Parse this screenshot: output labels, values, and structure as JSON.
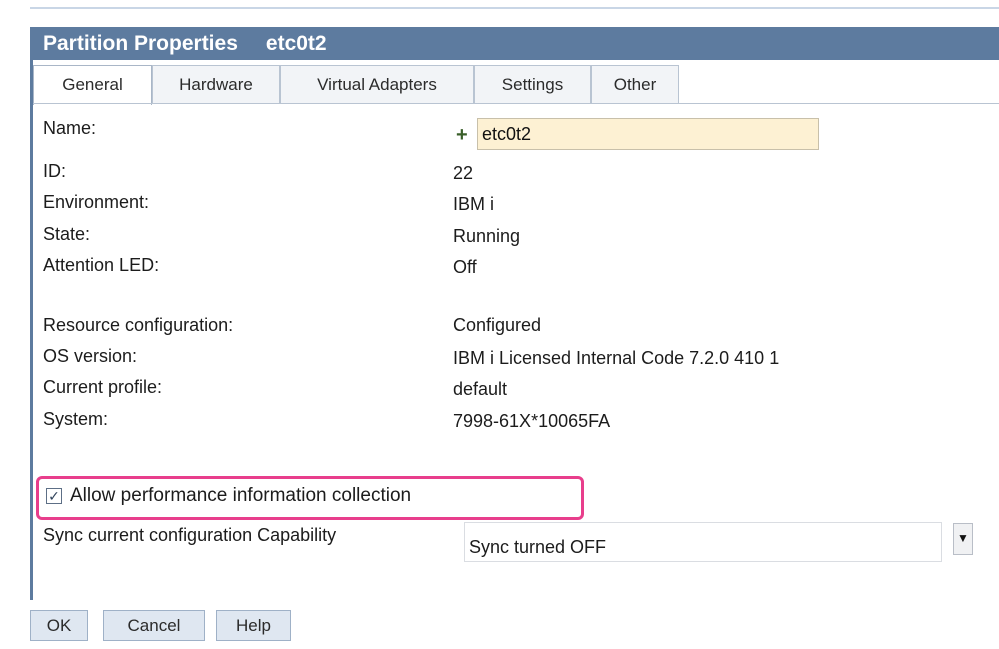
{
  "title": {
    "text": "Partition Properties",
    "partition_name": "etc0t2"
  },
  "tabs": [
    {
      "label": "General",
      "active": true
    },
    {
      "label": "Hardware"
    },
    {
      "label": "Virtual Adapters"
    },
    {
      "label": "Settings"
    },
    {
      "label": "Other"
    }
  ],
  "general": {
    "name_label": "Name:",
    "name_value": "etc0t2",
    "id_label": "ID:",
    "id_value": "22",
    "environment_label": "Environment:",
    "environment_value": "IBM i",
    "state_label": "State:",
    "state_value": "Running",
    "attention_led_label": "Attention LED:",
    "attention_led_value": "Off",
    "resource_config_label": "Resource configuration:",
    "resource_config_value": "Configured",
    "os_version_label": "OS version:",
    "os_version_value": "IBM i Licensed Internal Code 7.2.0 410 1",
    "current_profile_label": "Current profile:",
    "current_profile_value": "default",
    "system_label": "System:",
    "system_value": "7998-61X*10065FA",
    "perf_collection_label": "Allow performance information collection",
    "perf_collection_checked": true,
    "sync_label": "Sync current configuration Capability",
    "sync_value": "Sync turned OFF"
  },
  "buttons": {
    "ok": "OK",
    "cancel": "Cancel",
    "help": "Help"
  },
  "colors": {
    "titlebar": "#5d7b9f",
    "highlight": "#e83e8c",
    "name_field_bg": "#fdf1d3"
  }
}
